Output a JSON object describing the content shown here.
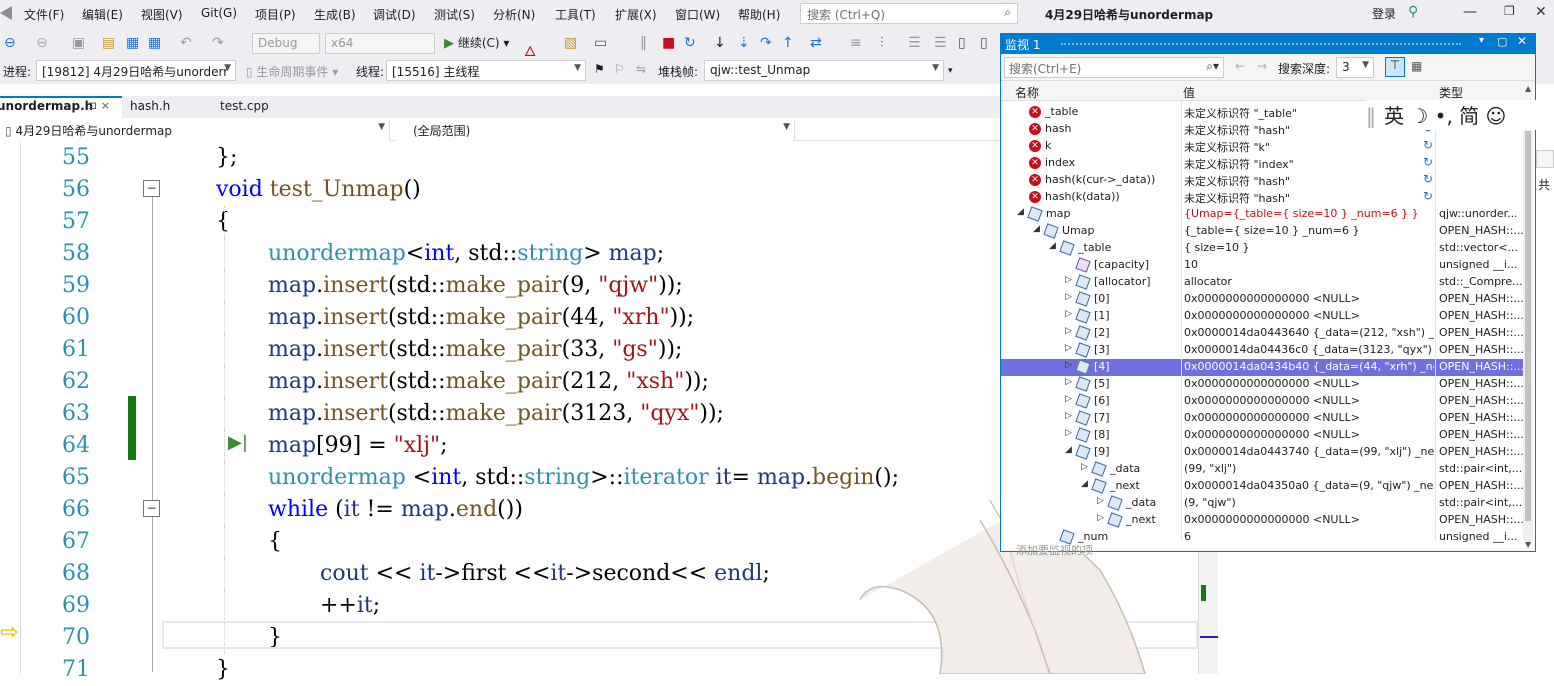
{
  "menu": [
    "文件(F)",
    "编辑(E)",
    "视图(V)",
    "Git(G)",
    "项目(P)",
    "生成(B)",
    "调试(D)",
    "测试(S)",
    "分析(N)",
    "工具(T)",
    "扩展(X)",
    "窗口(W)",
    "帮助(H)"
  ],
  "search_placeholder": "搜索 (Ctrl+Q)",
  "window_title": "4月29日哈希与unordermap",
  "login": "登录",
  "toolbar": {
    "config": "Debug",
    "platform": "x64",
    "continue": "继续(C)"
  },
  "debugbar": {
    "process_label": "进程:",
    "process_value": "[19812] 4月29日哈希与unorderr",
    "lifecycle": "生命周期事件",
    "thread_label": "线程:",
    "thread_value": "[15516] 主线程",
    "stack_label": "堆栈帧:",
    "stack_value": "qjw::test_Unmap"
  },
  "tabs": [
    "unordermap.h",
    "hash.h",
    "test.cpp"
  ],
  "tab_pin": "⊐ ×",
  "nav": {
    "project": "4月29日哈希与unordermap",
    "scope": "(全局范围)"
  },
  "code_lines": [
    {
      "n": "55",
      "t": "};"
    },
    {
      "n": "56",
      "t": "void test_Unmap()"
    },
    {
      "n": "57",
      "t": "{"
    },
    {
      "n": "58",
      "t": "unordermap<int, std::string> map;"
    },
    {
      "n": "59",
      "t": "map.insert(std::make_pair(9, \"qjw\"));"
    },
    {
      "n": "60",
      "t": "map.insert(std::make_pair(44, \"xrh\"));"
    },
    {
      "n": "61",
      "t": "map.insert(std::make_pair(33, \"gs\"));"
    },
    {
      "n": "62",
      "t": "map.insert(std::make_pair(212, \"xsh\"));"
    },
    {
      "n": "63",
      "t": "map.insert(std::make_pair(3123, \"qyx\"));"
    },
    {
      "n": "64",
      "t": "map[99] = \"xlj\";"
    },
    {
      "n": "65",
      "t": "unordermap <int, std::string>::iterator it= map.begin();"
    },
    {
      "n": "66",
      "t": "while (it != map.end())"
    },
    {
      "n": "67",
      "t": "{"
    },
    {
      "n": "68",
      "t": "cout << it->first <<it->second<< endl;"
    },
    {
      "n": "69",
      "t": "++it;"
    },
    {
      "n": "70",
      "t": "}"
    },
    {
      "n": "71",
      "t": "}"
    }
  ],
  "watch": {
    "title": "监视 1",
    "search_placeholder": "搜索(Ctrl+E)",
    "depth_label": "搜索深度:",
    "depth_value": "3",
    "col_name": "名称",
    "col_value": "值",
    "col_type": "类型",
    "add_hint": "添加要监视的项",
    "rows": [
      {
        "icon": "error",
        "name": "_table",
        "value": "未定义标识符 \"_table\"",
        "type": ""
      },
      {
        "icon": "error",
        "name": "hash",
        "value": "未定义标识符 \"hash\"",
        "type": "",
        "refresh": true
      },
      {
        "icon": "error",
        "name": "k",
        "value": "未定义标识符 \"k\"",
        "type": "",
        "refresh": true
      },
      {
        "icon": "error",
        "name": "index",
        "value": "未定义标识符 \"index\"",
        "type": "",
        "refresh": true
      },
      {
        "icon": "error",
        "name": "hash(k(cur->_data))",
        "value": "未定义标识符 \"hash\"",
        "type": "",
        "refresh": true
      },
      {
        "icon": "error",
        "name": "hash(k(data))",
        "value": "未定义标识符 \"hash\"",
        "type": "",
        "refresh": true
      },
      {
        "icon": "cube",
        "name": "map",
        "value": "{Umap={_table={ size=10 } _num=6 } }",
        "type": "qjw::unorder...",
        "expanded": true,
        "red": true,
        "level": 0
      },
      {
        "icon": "cube",
        "name": "Umap",
        "value": "{_table={ size=10 } _num=6 }",
        "type": "OPEN_HASH::...",
        "expanded": true,
        "level": 1
      },
      {
        "icon": "cube",
        "name": "_table",
        "value": "{ size=10 }",
        "type": "std::vector<...",
        "expanded": true,
        "level": 2
      },
      {
        "icon": "cubep",
        "name": "[capacity]",
        "value": "10",
        "type": "unsigned __i...",
        "level": 3
      },
      {
        "icon": "cube",
        "name": "[allocator]",
        "value": "allocator",
        "type": "std::_Compre...",
        "collapsed": true,
        "level": 3
      },
      {
        "icon": "cube",
        "name": "[0]",
        "value": "0x0000000000000000 <NULL>",
        "type": "OPEN_HASH::...",
        "collapsed": true,
        "level": 3
      },
      {
        "icon": "cube",
        "name": "[1]",
        "value": "0x0000000000000000 <NULL>",
        "type": "OPEN_HASH::...",
        "collapsed": true,
        "level": 3
      },
      {
        "icon": "cube",
        "name": "[2]",
        "value": "0x0000014da0443640 {_data=(212, \"xsh\") _nex...",
        "type": "OPEN_HASH::...",
        "collapsed": true,
        "level": 3
      },
      {
        "icon": "cube",
        "name": "[3]",
        "value": "0x0000014da04436c0 {_data=(3123, \"qyx\") _ne...",
        "type": "OPEN_HASH::...",
        "collapsed": true,
        "level": 3
      },
      {
        "icon": "cube",
        "name": "[4]",
        "value": "0x0000014da0434b40 {_data=(44, \"xrh\") _next...",
        "type": "OPEN_HASH::...",
        "collapsed": true,
        "level": 3,
        "selected": true
      },
      {
        "icon": "cube",
        "name": "[5]",
        "value": "0x0000000000000000 <NULL>",
        "type": "OPEN_HASH::...",
        "collapsed": true,
        "level": 3
      },
      {
        "icon": "cube",
        "name": "[6]",
        "value": "0x0000000000000000 <NULL>",
        "type": "OPEN_HASH::...",
        "collapsed": true,
        "level": 3
      },
      {
        "icon": "cube",
        "name": "[7]",
        "value": "0x0000000000000000 <NULL>",
        "type": "OPEN_HASH::...",
        "collapsed": true,
        "level": 3
      },
      {
        "icon": "cube",
        "name": "[8]",
        "value": "0x0000000000000000 <NULL>",
        "type": "OPEN_HASH::...",
        "collapsed": true,
        "level": 3
      },
      {
        "icon": "cube",
        "name": "[9]",
        "value": "0x0000014da0443740 {_data=(99, \"xlj\") _next=...",
        "type": "OPEN_HASH::...",
        "expanded": true,
        "level": 3
      },
      {
        "icon": "cube",
        "name": "_data",
        "value": "(99, \"xlj\")",
        "type": "std::pair<int,...",
        "collapsed": true,
        "level": 4
      },
      {
        "icon": "cube",
        "name": "_next",
        "value": "0x0000014da04350a0 {_data=(9, \"qjw\") _next=...",
        "type": "OPEN_HASH::...",
        "expanded": true,
        "level": 4
      },
      {
        "icon": "cube",
        "name": "_data",
        "value": "(9, \"qjw\")",
        "type": "std::pair<int,...",
        "collapsed": true,
        "level": 5
      },
      {
        "icon": "cube",
        "name": "_next",
        "value": "0x0000000000000000 <NULL>",
        "type": "OPEN_HASH::...",
        "collapsed": true,
        "level": 5
      },
      {
        "icon": "cube",
        "name": "_num",
        "value": "6",
        "type": "unsigned __i...",
        "level": 2
      }
    ]
  },
  "ime": "英 ☽ •, 简 ☺",
  "side_label": "共"
}
